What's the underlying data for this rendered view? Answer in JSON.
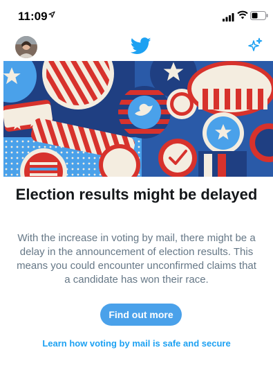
{
  "status_bar": {
    "time": "11:09",
    "location_icon": "location-arrow-icon",
    "signal_icon": "cellular-signal-icon",
    "wifi_icon": "wifi-icon",
    "battery_icon": "battery-icon"
  },
  "nav": {
    "avatar_icon": "profile-avatar",
    "logo_icon": "twitter-bird-icon",
    "sparkle_icon": "sparkle-icon",
    "brand_color": "#1da1f2"
  },
  "banner": {
    "image": "election-buttons-illustration",
    "colors": [
      "#1f3f82",
      "#d7322c",
      "#f4ede0",
      "#4aa1ea"
    ]
  },
  "content": {
    "headline": "Election results might be delayed",
    "body": "With the increase in voting by mail, there might be a delay in the announcement of election results. This means you could encounter unconfirmed claims that a candidate has won their race.",
    "cta_label": "Find out more",
    "link_label": "Learn how voting by mail is safe and secure"
  }
}
